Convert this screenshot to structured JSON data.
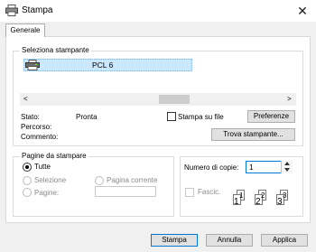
{
  "window": {
    "title": "Stampa",
    "close_glyph": "✕"
  },
  "tabs": [
    {
      "label": "Generale"
    }
  ],
  "printer_selection": {
    "label": "Seleziona stampante",
    "selected_printer": "PCL 6",
    "scroll_left": "<",
    "scroll_right": ">"
  },
  "status": {
    "stato_label": "Stato:",
    "stato_value": "Pronta",
    "percorso_label": "Percorso:",
    "commento_label": "Commento:",
    "print_to_file_label": "Stampa su file",
    "print_to_file_checked": false,
    "preferences_button": "Preferenze",
    "find_printer_button": "Trova stampante..."
  },
  "pages": {
    "label": "Pagine da stampare",
    "all": "Tutte",
    "selection": "Selezione",
    "current": "Pagina corrente",
    "pages": "Pagine:",
    "pages_value": ""
  },
  "copies": {
    "label": "Numero di copie:",
    "value": "1",
    "collate_label": "Fascic.",
    "collate_checked": false,
    "collate_pages": [
      "1",
      "1",
      "2",
      "2",
      "3",
      "3"
    ]
  },
  "footer": {
    "print_button": "Stampa",
    "cancel_button": "Annulla",
    "apply_button": "Applica"
  },
  "icons": {
    "title": "printer-icon",
    "printer_item": "printer-icon",
    "collate": "collate-pages-icon"
  },
  "colors": {
    "selection_bg": "#cce8ff",
    "default_button_border": "#0078d7",
    "disabled_text": "#8a8a8a"
  }
}
